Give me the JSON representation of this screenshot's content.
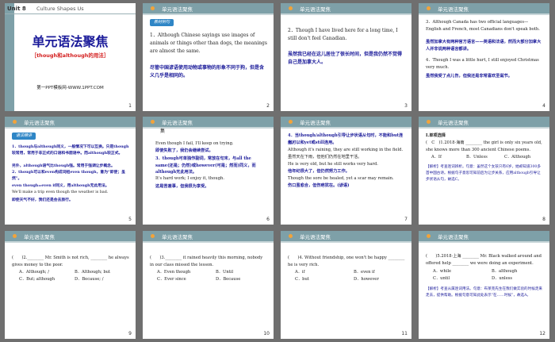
{
  "slide1": {
    "unit": "Unit 8",
    "unit_title": "Culture Shapes Us",
    "title": "单元语法聚焦",
    "subtitle": "［though和although的用法］",
    "footer": "第一PPT模板网-WWW.1PPT.COM",
    "num": "1"
  },
  "header": "单元语法聚焦",
  "slide2": {
    "tag": "教材例句",
    "line1": "1．Although Chinese sayings use images of animals or things other than dogs, the meanings are almost the same.",
    "line2": "尽管中国谚语使用动物或事物的形象不同于狗，但是含义几乎是相同的。",
    "num": "2"
  },
  "slide3": {
    "line1": "2．Though I have lived here for a long time, I still don't feel Canadian.",
    "line2": "虽然我已经在这儿居住了很长时间，但是我仍然不觉得自己是加拿大人。",
    "num": "3"
  },
  "slide4": {
    "l1": "3．Although Canada has two official languages—English and French, most Canadians don't speak both.",
    "l2": "虽然加拿大有两种官方语言——英语和法语，然而大部分加拿大人并非说两种语言都讲。",
    "l3": "4．Though I was a little hurt, I still enjoyed Christmas very much.",
    "l4": "虽然我受了点儿伤，但我还是非常喜欢圣诞节。",
    "num": "4"
  },
  "slide5": {
    "tag": "语法精讲",
    "l1": "1．though与although同义，一般情况下可以互换。只是though较常用，常用于非正式的口语和书面语中。而although较正式。",
    "l2": "另外，although语气比though强。常用于强调让步概念。",
    "l3": "2．though可以和even构成词组even though，意为“即使；虽然”。",
    "l4": "even though=even if同义，用although无此用法。",
    "l5": "We'll make a trip even though the weather is bad.",
    "l6": "即使天气不好，我们还是会去旅行。",
    "num": "5"
  },
  "slide6": {
    "tab": "集",
    "l1": "Even though I fail, I'll keep on trying.",
    "l2": "即使失败了，我仍会继续尝试。",
    "l3": "3．though可单独作副词，常放在句末，与all the same(还是；仍然)或however(可是；然而)同义，而although无此用法。",
    "l4": "It's hard work; I enjoy it, though.",
    "l5": "这是苦差事，但我很为享受。",
    "num": "6"
  },
  "slide7": {
    "l1": "4．当though/although引导让步状语从句时，不能和but连用。",
    "l2": "但可以和yet或still连用。",
    "l3": "Although it's raining, they are still working in the field. 虽然天在下雨，但他们仍然在地里干活。",
    "l4": "He is very old, but he still works very hard.",
    "l5": "他年纪很大了，但仍然努力工作。",
    "l6": "Though the sore be healed, yet a scar may remain.",
    "l7": "伤口虽愈合，但伤疤犹在。(谚语)",
    "num": "7"
  },
  "slide8": {
    "h1": "Ⅰ.单项选择",
    "q": "(　C　)1.2018·海南 ________ the girl is only six years old, she knows more than 300 ancient Chinese poems.",
    "a": "A．If",
    "b": "B．Unless",
    "c": "C．Although",
    "analysis": "【解析】考查连词辨析。句意：虽然这个女孩只有6岁，她却知道300多首中国古诗。根据句子意思可知前后为让步关系，应用although引导让步状语从句，故选C。",
    "num": "8"
  },
  "slide9": {
    "q": "(　　)2.________ Mr. Smith is not rich, ________ he always gives money to the poor.",
    "a": "A．Although; /",
    "b": "B．Although; but",
    "c": "C．But; although",
    "d": "D．Because; /",
    "num": "9"
  },
  "slide10": {
    "q": "(　　)3.________ it rained heavily this morning, nobody in our class missed the lesson.",
    "a": "A．Even though",
    "b": "B．Until",
    "c": "C．Ever since",
    "d": "D．Because",
    "num": "10"
  },
  "slide11": {
    "q": "(　　)4. Without friendship, one won't be happy ________ he is very rich.",
    "a": "A．if",
    "b": "B．even if",
    "c": "C．but",
    "d": "D．however",
    "num": "11"
  },
  "slide12": {
    "q": "(　　)5.2018·上海 ________ Mr. Black walked around and offered help ________ we were doing an experiment.",
    "a": "A．while",
    "b": "B．although",
    "c": "C．until",
    "d": "D．unless",
    "analysis": "【解析】考查从属连词用法。句意：布莱克先生在我们做实验的时候走来走去，提供帮助。根据句意可知此处表示“在……时候”，故选A。",
    "num": "12"
  }
}
